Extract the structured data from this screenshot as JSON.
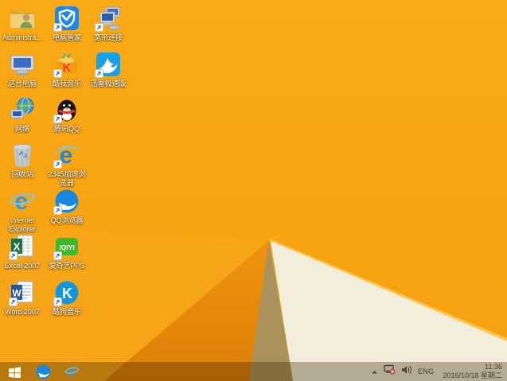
{
  "wallpaper": {
    "base_orange": "#F7A512",
    "light_wedge": "#F9AC20",
    "dark_orange_triangle": "#E5860A",
    "olive_wedge": "#A9935B",
    "cream_triangle": "#F3EEDC",
    "cream_edge_highlight": "#FFC34A"
  },
  "desktop": {
    "icons": [
      {
        "id": "administrator",
        "label": "Administra...",
        "glyph": "folder-user",
        "col": 0,
        "row": 0,
        "shortcut": false
      },
      {
        "id": "pc-manager",
        "label": "电脑管家",
        "glyph": "shield-check",
        "col": 1,
        "row": 0,
        "shortcut": true
      },
      {
        "id": "broadband",
        "label": "宽带连接",
        "glyph": "two-computers",
        "col": 2,
        "row": 0,
        "shortcut": true
      },
      {
        "id": "this-pc",
        "label": "这台电脑",
        "glyph": "computer",
        "col": 0,
        "row": 1,
        "shortcut": false
      },
      {
        "id": "kuwo-music",
        "label": "酷我音乐",
        "glyph": "music-box",
        "col": 1,
        "row": 1,
        "shortcut": true
      },
      {
        "id": "xunlei",
        "label": "迅雷极速版",
        "glyph": "hummingbird",
        "col": 2,
        "row": 1,
        "shortcut": true
      },
      {
        "id": "network",
        "label": "网络",
        "glyph": "globe-computer",
        "col": 0,
        "row": 2,
        "shortcut": false
      },
      {
        "id": "tencent-qq",
        "label": "腾讯QQ",
        "glyph": "penguin",
        "col": 1,
        "row": 2,
        "shortcut": true
      },
      {
        "id": "recycle-bin",
        "label": "回收站",
        "glyph": "trash-can",
        "col": 0,
        "row": 3,
        "shortcut": false
      },
      {
        "id": "2345-browser",
        "label": "2345加速浏览器",
        "glyph": "blue-e-swoosh",
        "col": 1,
        "row": 3,
        "shortcut": true
      },
      {
        "id": "internet-explorer",
        "label": "Internet Explorer",
        "glyph": "ie-e",
        "col": 0,
        "row": 4,
        "shortcut": false
      },
      {
        "id": "qq-browser",
        "label": "QQ浏览器",
        "glyph": "blue-circle-swirl",
        "col": 1,
        "row": 4,
        "shortcut": true
      },
      {
        "id": "excel-2007",
        "label": "Excel 2007",
        "glyph": "excel-sheet",
        "col": 0,
        "row": 5,
        "shortcut": true
      },
      {
        "id": "iqiyi-pps",
        "label": "爱奇艺PPS",
        "glyph": "iqiyi-green",
        "col": 1,
        "row": 5,
        "shortcut": true
      },
      {
        "id": "word-2007",
        "label": "Word 2007",
        "glyph": "word-doc",
        "col": 0,
        "row": 6,
        "shortcut": true
      },
      {
        "id": "kugou-music",
        "label": "酷狗音乐",
        "glyph": "blue-circle-k",
        "col": 1,
        "row": 6,
        "shortcut": true
      }
    ]
  },
  "taskbar": {
    "start_button": {
      "id": "start",
      "glyph": "windows-flag"
    },
    "pinned": [
      {
        "id": "qq-browser-task",
        "glyph": "blue-circle-swirl-task"
      },
      {
        "id": "ie-task",
        "glyph": "ie-e-task"
      }
    ],
    "tray": {
      "language": "ENG",
      "time": "11:36",
      "date": "2016/10/18 星期二"
    }
  }
}
